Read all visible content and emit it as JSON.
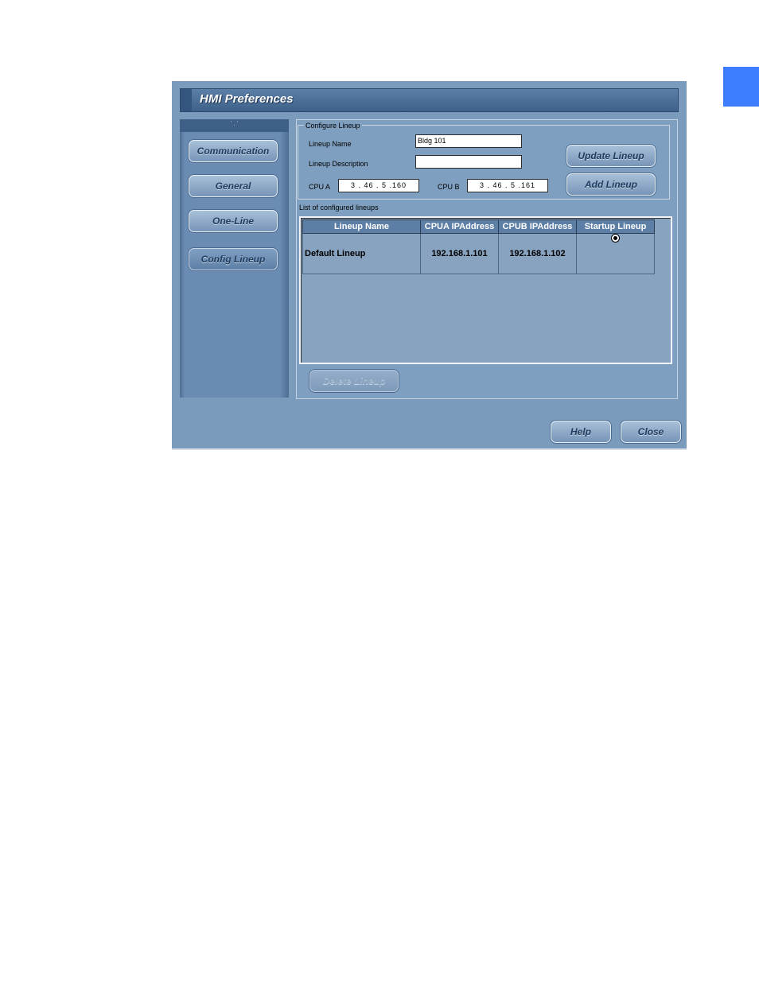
{
  "window": {
    "title": "HMI Preferences"
  },
  "sidebar": {
    "header": "' . '",
    "items": [
      {
        "label": "Communication"
      },
      {
        "label": "General"
      },
      {
        "label": "One-Line"
      },
      {
        "label": "Config Lineup",
        "active": true
      }
    ]
  },
  "configure": {
    "group_label": "Configure Lineup",
    "name_label": "Lineup Name",
    "name_value": "Bldg 101",
    "description_label": "Lineup Description",
    "description_value": "",
    "cpu_a_label": "CPU A",
    "cpu_a_value": "3 . 46 . 5 .160",
    "cpu_b_label": "CPU B",
    "cpu_b_value": "3 . 46 . 5 .161",
    "update_button": "Update Lineup",
    "add_button": "Add Lineup"
  },
  "lineups": {
    "list_label": "List of configured lineups",
    "columns": [
      "Lineup Name",
      "CPUA IPAddress",
      "CPUB IPAddress",
      "Startup Lineup"
    ],
    "rows": [
      {
        "name": "Default Lineup",
        "cpua": "192.168.1.101",
        "cpub": "192.168.1.102",
        "startup": true
      }
    ],
    "delete_button": "Delete Lineup"
  },
  "footer": {
    "help_button": "Help",
    "close_button": "Close"
  },
  "colors": {
    "window_bg": "#7a9bbb",
    "title_bar": "#3e618a",
    "accent_tab": "#3e7cff"
  }
}
